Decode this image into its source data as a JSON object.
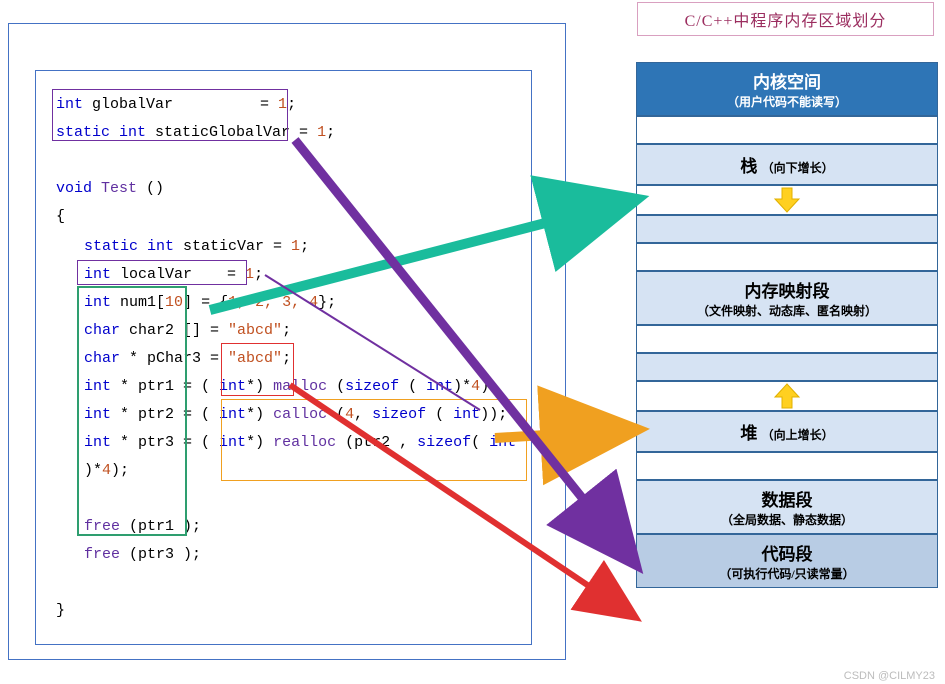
{
  "title": "C/C++中程序内存区域划分",
  "code": {
    "line1_kw": "int",
    "line1_id": " globalVar",
    "line1_eq": " = ",
    "line1_v": "1",
    "line1_end": ";",
    "line2_kw": "static int",
    "line2_id": " staticGlobalVar",
    "line2_eq": " = ",
    "line2_v": "1",
    "line2_end": ";",
    "line4_kw": "void",
    "line4_fn": " Test",
    "line4_par": " ()",
    "line5": "{",
    "line6_kw": "static int",
    "line6_id": " staticVar",
    "line6_eq": " = ",
    "line6_v": "1",
    "line6_end": ";",
    "line7_kw": "int",
    "line7_id": " localVar",
    "line7_eq": "  = ",
    "line7_v": "1",
    "line7_end": ";",
    "line8_kw": "int",
    "line8_id": " num1",
    "line8_br": "[",
    "line8_sz": "10",
    "line8_br2": "]  = {",
    "line8_vals": "1, 2, 3, 4",
    "line8_end": "};",
    "line9_kw": "char",
    "line9_id": " char2 []   = ",
    "line9_str": "\"abcd\"",
    "line9_end": ";",
    "line10_kw": "char",
    "line10_id": " * pChar3 = ",
    "line10_str": "\"abcd\"",
    "line10_end": ";",
    "line11_kw": "int",
    "line11_id": " * ptr1       = ( ",
    "line11_cast": "int",
    "line11_id2": "*) ",
    "line11_fn": "malloc",
    "line11_p1": " (",
    "line11_so": "sizeof",
    "line11_p2": " ( ",
    "line11_ty": "int",
    "line11_p3": ")*",
    "line11_v": "4",
    "line11_end": ");",
    "line12_kw": "int",
    "line12_id": " * ptr2       = ( ",
    "line12_cast": "int",
    "line12_id2": "*) ",
    "line12_fn": "calloc",
    "line12_p1": " (",
    "line12_v": "4",
    "line12_c": ", ",
    "line12_so": "sizeof",
    "line12_p2": " ( ",
    "line12_ty": "int",
    "line12_end": "));",
    "line13_kw": "int",
    "line13_id": " * ptr3       = ( ",
    "line13_cast": "int",
    "line13_id2": "*) ",
    "line13_fn": "realloc",
    "line13_p1": " (ptr2 , ",
    "line13_so": "sizeof",
    "line13_p2": "( ",
    "line13_ty": "int",
    "line13_p3": " )*",
    "line13_v": "4",
    "line13_end": ");",
    "line15_fn": "free",
    "line15_rest": " (ptr1 );",
    "line16_fn": "free",
    "line16_rest": " (ptr3 );",
    "line18": "}"
  },
  "memory": {
    "kernel_title": "内核空间",
    "kernel_sub": "（用户代码不能读写）",
    "stack": "栈",
    "stack_sub": "（向下增长）",
    "mmap_title": "内存映射段",
    "mmap_sub": "（文件映射、动态库、匿名映射）",
    "heap": "堆",
    "heap_sub": "（向上增长）",
    "data_title": "数据段",
    "data_sub": "（全局数据、静态数据）",
    "code_title": "代码段",
    "code_sub": "（可执行代码/只读常量）"
  },
  "watermark": "CSDN @CILMY23",
  "arrows": {
    "green": {
      "from": "localVar/num1/char2 (stack vars)",
      "to": "栈"
    },
    "orange": {
      "from": "malloc/calloc/realloc returns",
      "to": "堆"
    },
    "purple": {
      "from": "globalVar/staticGlobalVar/staticVar",
      "to": "数据段"
    },
    "red": {
      "from": "\"abcd\" string literal",
      "to": "代码段"
    }
  },
  "chart_data": {
    "type": "diagram",
    "topic": "C/C++ program memory layout regions",
    "regions_top_to_bottom": [
      "内核空间",
      "栈",
      "内存映射段",
      "堆",
      "数据段",
      "代码段"
    ],
    "growth": {
      "栈": "向下增长",
      "堆": "向上增长"
    },
    "mappings": [
      {
        "color": "green",
        "source": [
          "localVar",
          "num1",
          "char2 array storage"
        ],
        "target": "栈"
      },
      {
        "color": "orange",
        "source": [
          "malloc result",
          "calloc result",
          "realloc result"
        ],
        "target": "堆"
      },
      {
        "color": "purple",
        "source": [
          "globalVar",
          "staticGlobalVar",
          "staticVar"
        ],
        "target": "数据段"
      },
      {
        "color": "red",
        "source": [
          "\"abcd\" literal"
        ],
        "target": "代码段"
      }
    ]
  }
}
